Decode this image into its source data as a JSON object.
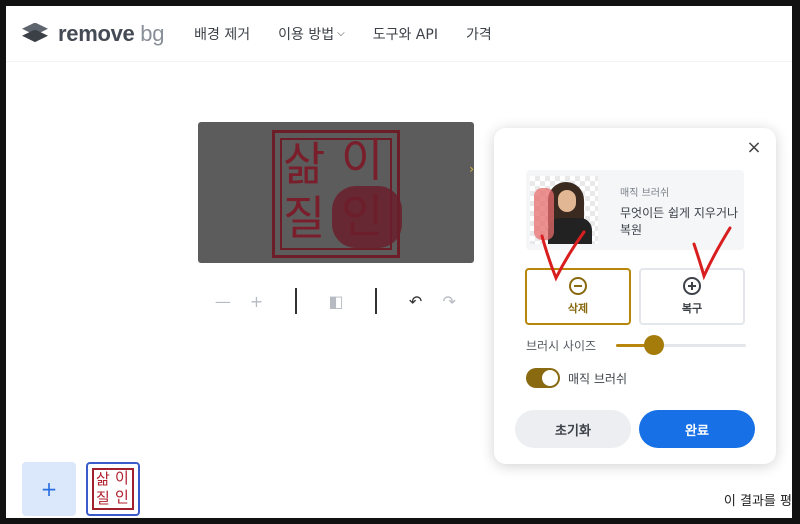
{
  "brand": {
    "name_main": "remove",
    "name_suffix": "bg"
  },
  "nav": {
    "items": [
      {
        "label": "배경 제거"
      },
      {
        "label": "이용 방법",
        "has_dropdown": true
      },
      {
        "label": "도구와 API"
      },
      {
        "label": "가격"
      }
    ]
  },
  "preview": {
    "stamp_chars": [
      "삶",
      "이",
      "질",
      "인"
    ]
  },
  "toolbar": {
    "zoom_out_icon": "minus-icon",
    "zoom_in_icon": "plus-icon",
    "compare_icon": "compare-icon",
    "undo_icon": "undo-icon",
    "redo_icon": "redo-icon"
  },
  "panel": {
    "close_symbol": "×",
    "info_title": "매직 브러쉬",
    "info_desc": "무엇이든 쉽게 지우거나 복원",
    "modes": [
      {
        "label": "삭제",
        "icon": "minus-circle-icon",
        "active": true
      },
      {
        "label": "복구",
        "icon": "plus-circle-icon",
        "active": false
      }
    ],
    "brush_size_label": "브러시 사이즈",
    "brush_size_fraction": 0.25,
    "magic_brush_label": "매직 브러쉬",
    "magic_brush_on": true,
    "reset_label": "초기화",
    "done_label": "완료"
  },
  "bottom": {
    "add_symbol": "+",
    "result_text": "이 결과를 평"
  },
  "colors": {
    "accent_gold": "#b8860b",
    "primary_blue": "#1770e6",
    "stamp_red": "#7a1e2b",
    "check_red": "#d81e1e"
  }
}
